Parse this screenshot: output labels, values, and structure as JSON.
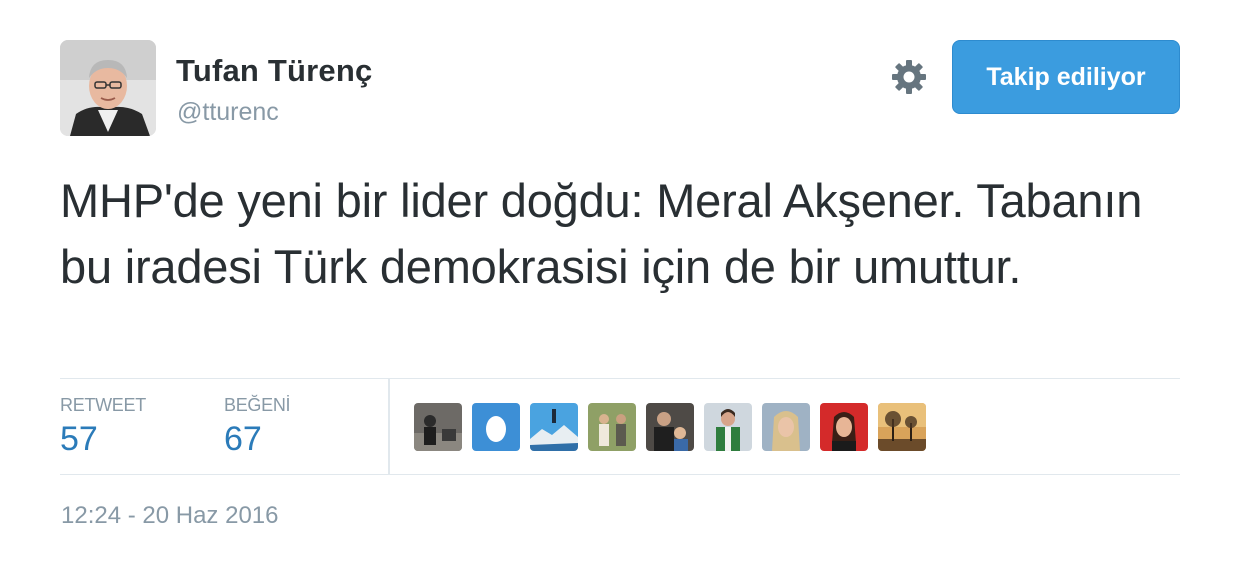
{
  "author": {
    "display_name": "Tufan Türenç",
    "handle": "@tturenc",
    "avatar_icon": "user-avatar-photo"
  },
  "header": {
    "settings_icon": "gear-icon",
    "follow_button_label": "Takip ediliyor",
    "follow_button_color": "#3b9cdf"
  },
  "tweet": {
    "text": "MHP'de yeni bir lider doğdu: Meral Akşener. Tabanın bu iradesi Türk demokrasisi için de bir umuttur."
  },
  "stats": {
    "retweet_label": "RETWEET",
    "retweet_count": "57",
    "like_label": "BEĞENİ",
    "like_count": "67",
    "count_color": "#2b7bb9"
  },
  "likers": [
    {
      "icon": "liker-avatar-1"
    },
    {
      "icon": "default-egg-avatar"
    },
    {
      "icon": "liker-avatar-3"
    },
    {
      "icon": "liker-avatar-4"
    },
    {
      "icon": "liker-avatar-5"
    },
    {
      "icon": "liker-avatar-6"
    },
    {
      "icon": "liker-avatar-7"
    },
    {
      "icon": "liker-avatar-8"
    },
    {
      "icon": "liker-avatar-9"
    }
  ],
  "timestamp": "12:24 - 20 Haz 2016"
}
